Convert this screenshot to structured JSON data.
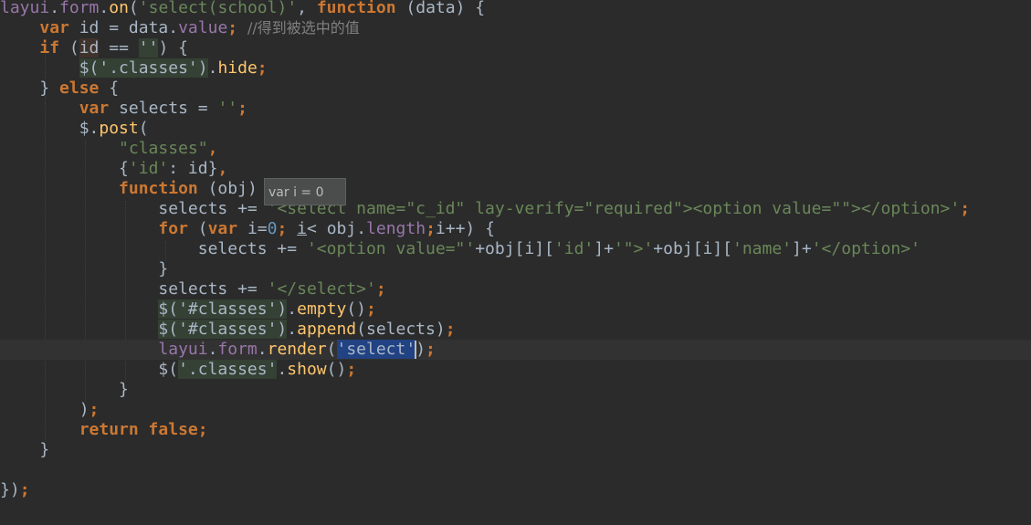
{
  "editor": {
    "tooltip": "var i = 0",
    "lines": [
      [
        [
          "prop",
          "layui"
        ],
        [
          "plain",
          "."
        ],
        [
          "prop",
          "form"
        ],
        [
          "plain",
          "."
        ],
        [
          "fn",
          "on"
        ],
        [
          "plain",
          "("
        ],
        [
          "str",
          "'select(school)'"
        ],
        [
          "plain",
          ", "
        ],
        [
          "kw",
          "function "
        ],
        [
          "plain",
          "(data) {"
        ]
      ],
      [
        [
          "plain",
          "    "
        ],
        [
          "kw",
          "var "
        ],
        [
          "plain",
          "id = data."
        ],
        [
          "prop",
          "value"
        ],
        [
          "kw",
          "; "
        ],
        [
          "cm",
          "//得到被选中的值"
        ]
      ],
      [
        [
          "plain",
          "    "
        ],
        [
          "kw",
          "if "
        ],
        [
          "plain",
          "("
        ],
        [
          "hlv",
          "id"
        ],
        [
          "plain",
          " == "
        ],
        [
          "hl",
          "''"
        ],
        [
          "plain",
          ") {"
        ]
      ],
      [
        [
          "plain",
          "        "
        ],
        [
          "hl",
          "$('.classes')"
        ],
        [
          "plain",
          "."
        ],
        [
          "fn",
          "hide"
        ],
        [
          "kw",
          ";"
        ]
      ],
      [
        [
          "plain",
          "    } "
        ],
        [
          "kw",
          "else "
        ],
        [
          "plain",
          "{"
        ]
      ],
      [
        [
          "plain",
          "        "
        ],
        [
          "kw",
          "var "
        ],
        [
          "plain",
          "selects = "
        ],
        [
          "str",
          "''"
        ],
        [
          "kw",
          ";"
        ]
      ],
      [
        [
          "plain",
          "        $."
        ],
        [
          "fn",
          "post"
        ],
        [
          "plain",
          "("
        ]
      ],
      [
        [
          "plain",
          "            "
        ],
        [
          "str",
          "\"classes\""
        ],
        [
          "kw",
          ","
        ]
      ],
      [
        [
          "plain",
          "            {"
        ],
        [
          "str",
          "'id'"
        ],
        [
          "plain",
          ": id}"
        ],
        [
          "kw",
          ","
        ]
      ],
      [
        [
          "plain",
          "            "
        ],
        [
          "kw",
          "function "
        ],
        [
          "plain",
          "(obj) {"
        ]
      ],
      [
        [
          "plain",
          "                selects += "
        ],
        [
          "str",
          "'<select name=\"c_id\" lay-verify=\"required\"><option value=\"\"></option>'"
        ],
        [
          "kw",
          ";"
        ]
      ],
      [
        [
          "plain",
          "                "
        ],
        [
          "kw",
          "for "
        ],
        [
          "plain",
          "("
        ],
        [
          "kw",
          "var "
        ],
        [
          "plain",
          "i="
        ],
        [
          "num",
          "0"
        ],
        [
          "kw",
          "; "
        ],
        [
          "under",
          "i"
        ],
        [
          "plain",
          "< obj."
        ],
        [
          "prop",
          "length"
        ],
        [
          "kw",
          ";"
        ],
        [
          "plain",
          "i++) {"
        ]
      ],
      [
        [
          "plain",
          "                    selects += "
        ],
        [
          "str",
          "'<option value=\"'"
        ],
        [
          "plain",
          "+obj[i]["
        ],
        [
          "str",
          "'id'"
        ],
        [
          "plain",
          "]+"
        ],
        [
          "str",
          "'\">'"
        ],
        [
          "plain",
          "+obj[i]["
        ],
        [
          "str",
          "'name'"
        ],
        [
          "plain",
          "]+"
        ],
        [
          "str",
          "'</option>'"
        ]
      ],
      [
        [
          "plain",
          "                }"
        ]
      ],
      [
        [
          "plain",
          "                selects += "
        ],
        [
          "str",
          "'</select>'"
        ],
        [
          "kw",
          ";"
        ]
      ],
      [
        [
          "plain",
          "                "
        ],
        [
          "hl",
          "$('#classes')"
        ],
        [
          "plain",
          "."
        ],
        [
          "fn",
          "empty"
        ],
        [
          "plain",
          "()"
        ],
        [
          "kw",
          ";"
        ]
      ],
      [
        [
          "plain",
          "                "
        ],
        [
          "hl",
          "$('#classes')"
        ],
        [
          "plain",
          "."
        ],
        [
          "fn",
          "append"
        ],
        [
          "plain",
          "(selects)"
        ],
        [
          "kw",
          ";"
        ]
      ],
      [
        [
          "plain",
          "                "
        ],
        [
          "prop",
          "layui"
        ],
        [
          "plain",
          "."
        ],
        [
          "prop",
          "form"
        ],
        [
          "plain",
          "."
        ],
        [
          "fn",
          "render"
        ],
        [
          "plain",
          "("
        ],
        [
          "sel",
          "'select'"
        ],
        [
          "caret",
          ""
        ],
        [
          "plain",
          ")"
        ],
        [
          "kw",
          ";"
        ]
      ],
      [
        [
          "plain",
          "                $("
        ],
        [
          "hl",
          "'.classes'"
        ],
        [
          "plain",
          "."
        ],
        [
          "fn",
          "show"
        ],
        [
          "plain",
          "()"
        ],
        [
          "kw",
          ";"
        ]
      ],
      [
        [
          "plain",
          "            }"
        ]
      ],
      [
        [
          "plain",
          "        )"
        ],
        [
          "kw",
          ";"
        ]
      ],
      [
        [
          "plain",
          "        "
        ],
        [
          "kw",
          "return false"
        ],
        [
          "kw",
          ";"
        ]
      ],
      [
        [
          "plain",
          "    }"
        ]
      ],
      [
        [
          "plain",
          ""
        ]
      ],
      [
        [
          "plain",
          "})"
        ],
        [
          "kw",
          ";"
        ]
      ]
    ]
  }
}
